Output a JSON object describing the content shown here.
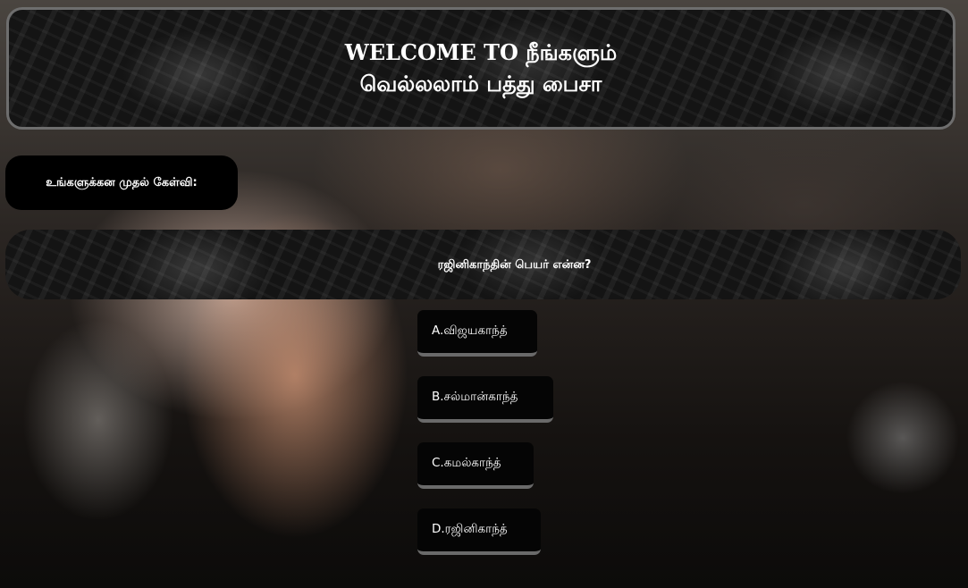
{
  "header": {
    "line1": "WELCOME TO நீங்களும்",
    "line2": "வெல்லலாம் பத்து பைசா"
  },
  "question_label": "உங்களுக்கன முதல் கேள்வி:",
  "question": "ரஜினிகாந்தின் பெயர் என்ன?",
  "options": [
    {
      "label": "A.விஜயகாந்த்"
    },
    {
      "label": "B.சல்மான்காந்த்"
    },
    {
      "label": "C.கமல்காந்த்"
    },
    {
      "label": "D.ரஜினிகாந்த்"
    }
  ]
}
